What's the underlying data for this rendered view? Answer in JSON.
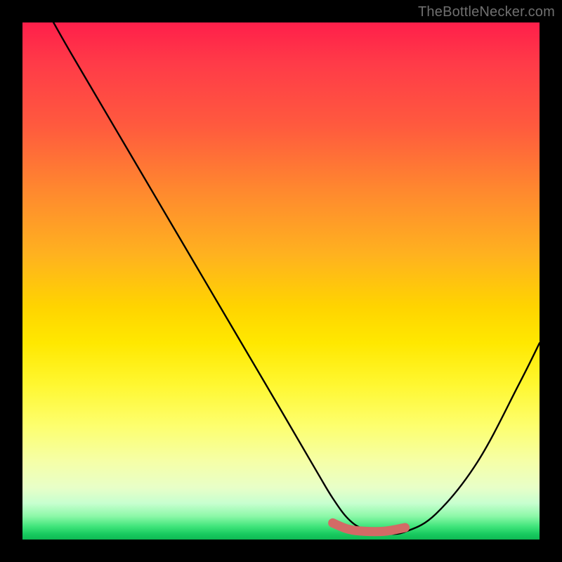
{
  "watermark": "TheBottleNecker.com",
  "chart_data": {
    "type": "line",
    "title": "",
    "xlabel": "",
    "ylabel": "",
    "xlim": [
      0,
      100
    ],
    "ylim": [
      0,
      100
    ],
    "series": [
      {
        "name": "curve",
        "x": [
          6,
          10,
          20,
          30,
          40,
          50,
          57,
          60,
          63,
          66,
          70,
          74,
          80,
          88,
          96,
          100
        ],
        "values": [
          100,
          93,
          76,
          59,
          42,
          25,
          13,
          8,
          4,
          2,
          1.2,
          1.5,
          5,
          15,
          30,
          38
        ],
        "color": "#000000"
      }
    ],
    "highlight_segment": {
      "color": "#d36a66",
      "x": [
        60,
        63,
        66,
        70,
        74
      ],
      "values": [
        3.2,
        2.0,
        1.6,
        1.6,
        2.3
      ]
    }
  }
}
